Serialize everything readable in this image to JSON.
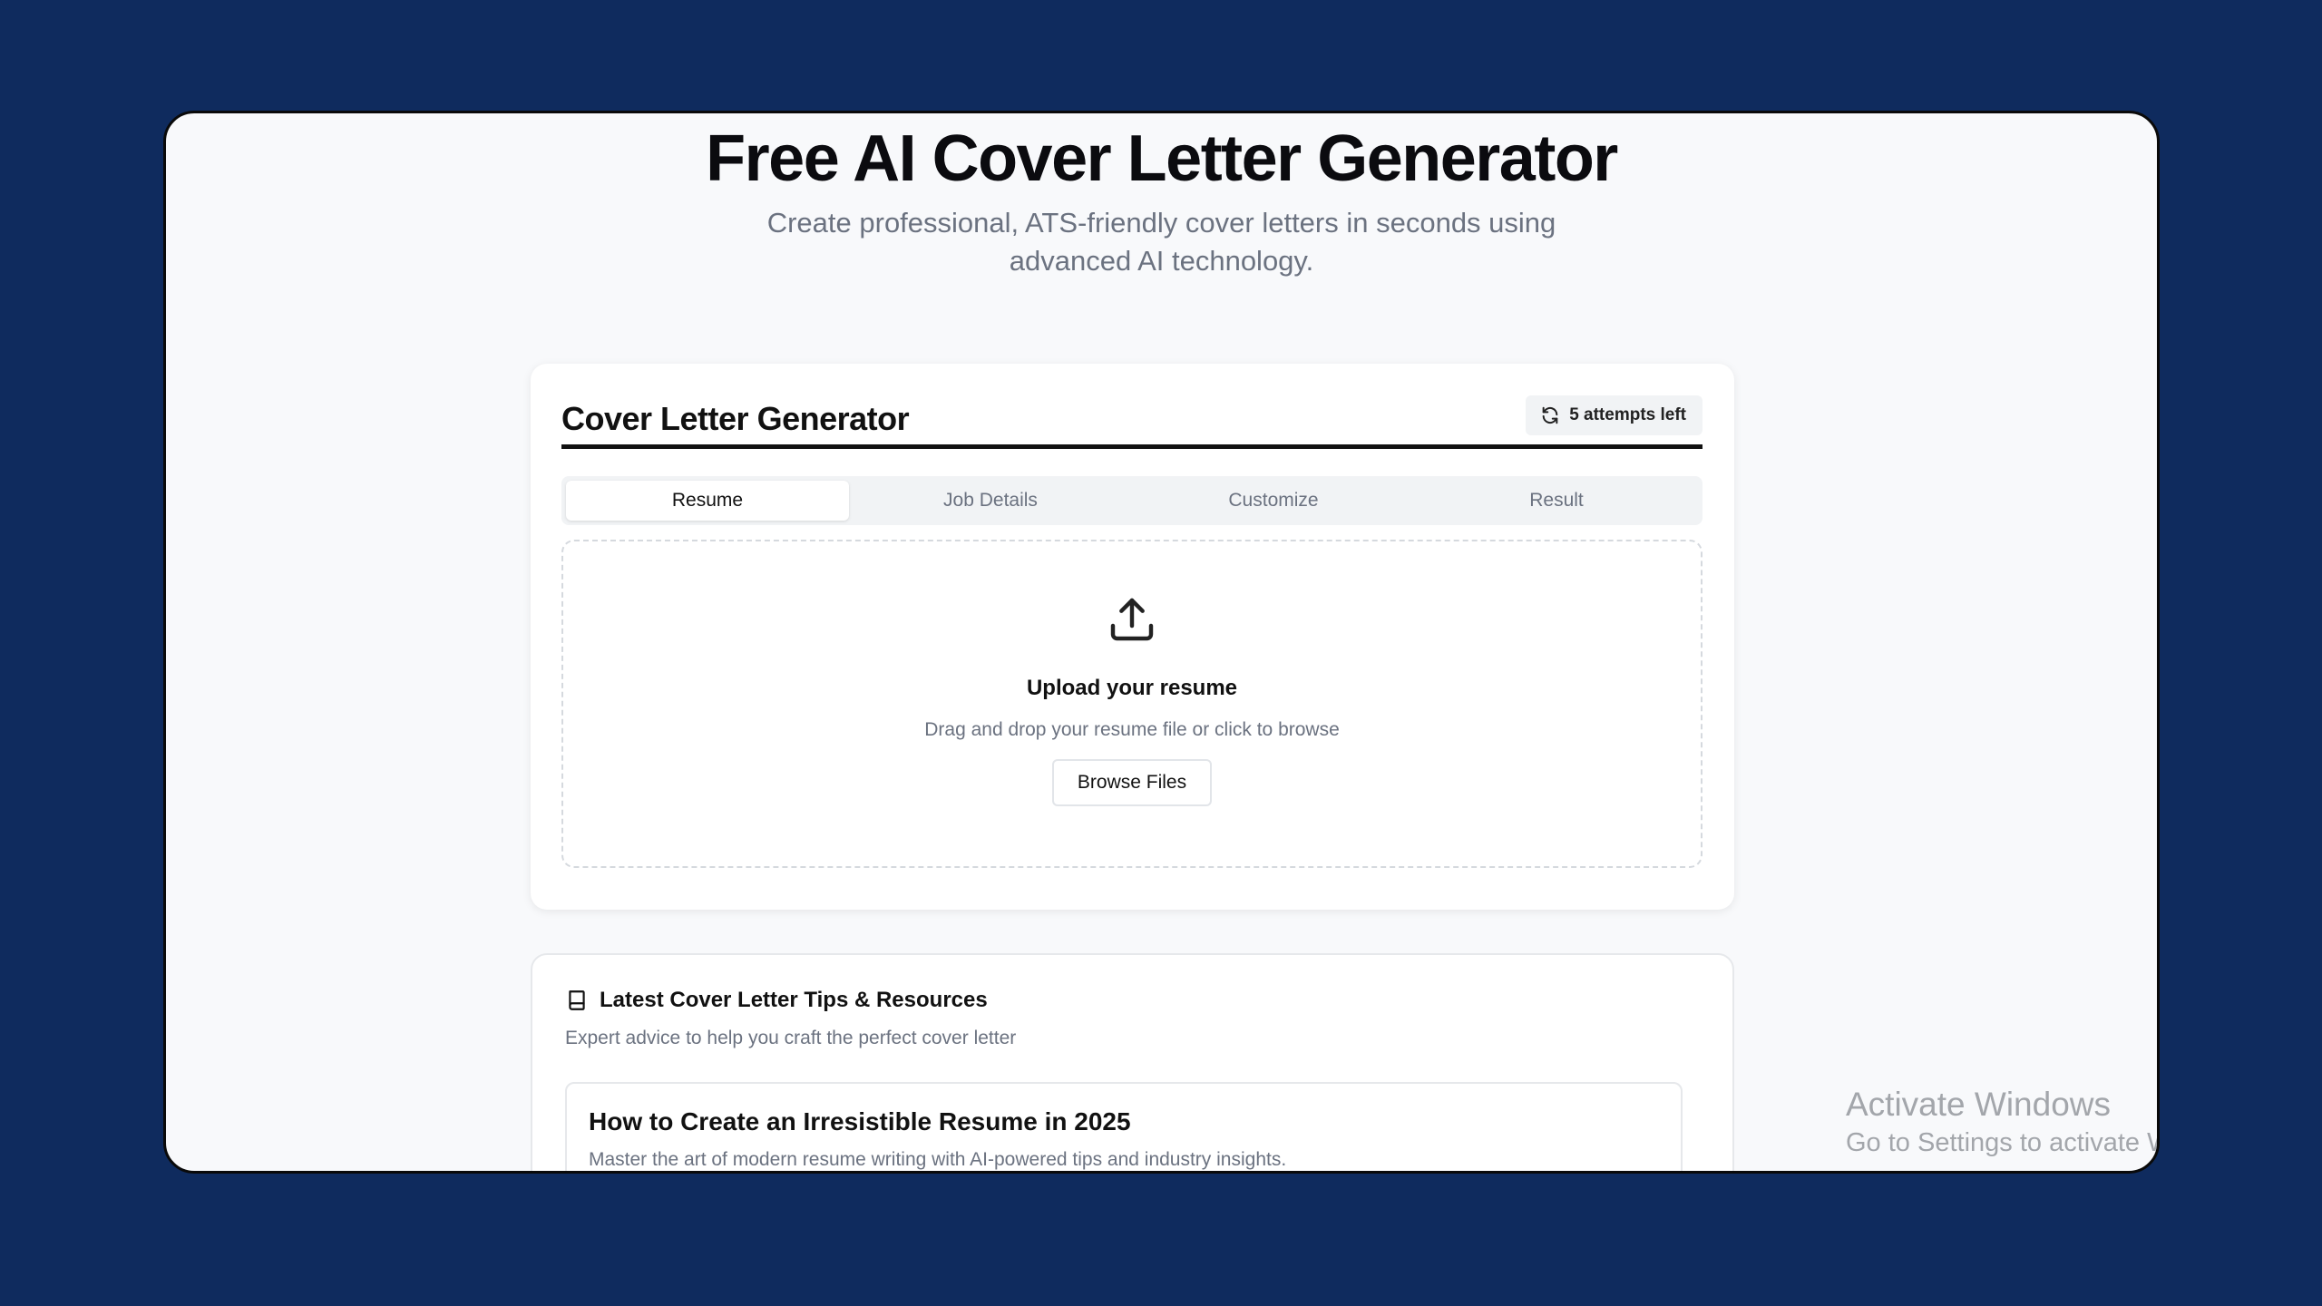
{
  "hero": {
    "title": "Free AI Cover Letter Generator",
    "subtitle": "Create professional, ATS-friendly cover letters in seconds using advanced AI technology."
  },
  "generator": {
    "title": "Cover Letter Generator",
    "attempts_label": "5 attempts left",
    "tabs": [
      {
        "label": "Resume",
        "active": true
      },
      {
        "label": "Job Details",
        "active": false
      },
      {
        "label": "Customize",
        "active": false
      },
      {
        "label": "Result",
        "active": false
      }
    ],
    "upload": {
      "icon": "upload-icon",
      "title": "Upload your resume",
      "subtitle": "Drag and drop your resume file or click to browse",
      "button_label": "Browse Files"
    }
  },
  "tips": {
    "icon": "book-icon",
    "title": "Latest Cover Letter Tips & Resources",
    "subtitle": "Expert advice to help you craft the perfect cover letter",
    "articles": [
      {
        "title": "How to Create an Irresistible Resume in 2025",
        "description": "Master the art of modern resume writing with AI-powered tips and industry insights."
      }
    ]
  },
  "watermark": {
    "line1": "Activate Windows",
    "line2": "Go to Settings to activate Windows."
  },
  "colors": {
    "backdrop": "#0f2b5e",
    "page_bg": "#f8f9fb",
    "text_primary": "#111111",
    "text_muted": "#6b7280"
  }
}
